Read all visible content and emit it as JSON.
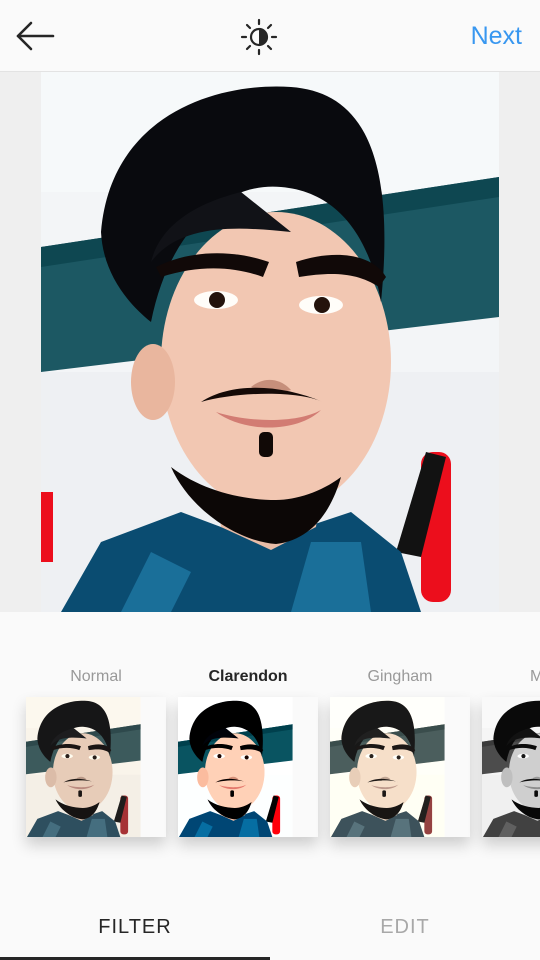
{
  "header": {
    "back_icon": "arrow-left-icon",
    "lux_icon": "brightness-lux-icon",
    "next_label": "Next",
    "accent_color": "#3897f0"
  },
  "filters": [
    {
      "name": "Normal",
      "selected": false
    },
    {
      "name": "Clarendon",
      "selected": true
    },
    {
      "name": "Gingham",
      "selected": false
    },
    {
      "name": "M",
      "selected": false
    }
  ],
  "tabs": {
    "filter_label": "FILTER",
    "edit_label": "EDIT",
    "active": "FILTER"
  }
}
